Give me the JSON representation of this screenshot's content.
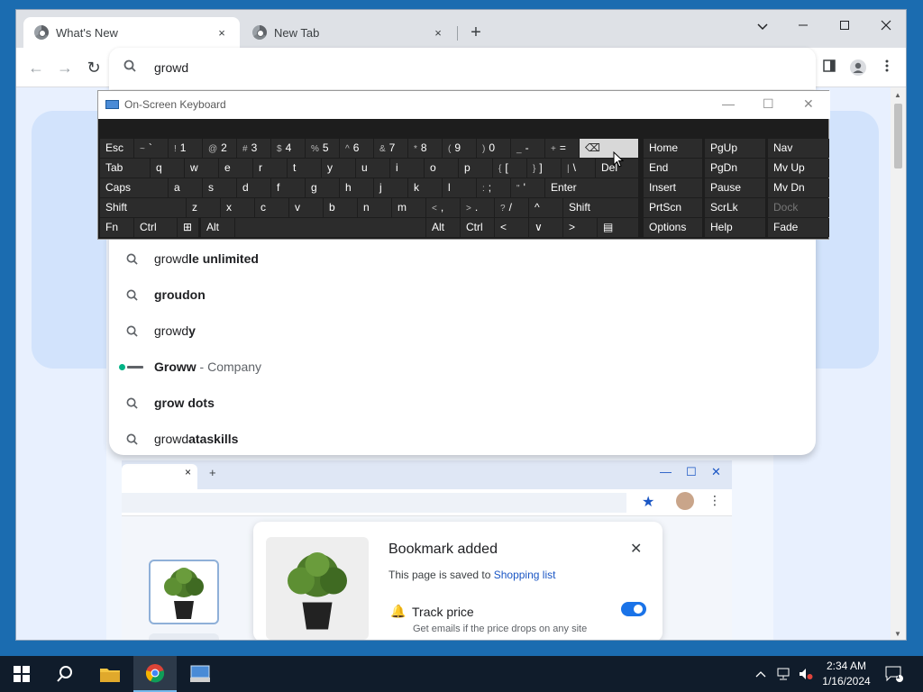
{
  "browser": {
    "tabs": [
      {
        "title": "What's New",
        "close": "×"
      },
      {
        "title": "New Tab",
        "close": "×"
      }
    ],
    "new_tab": "+",
    "window_controls": {
      "dropdown": "⌄",
      "minimize": "—",
      "maximize": "☐",
      "close": "✕"
    },
    "nav": {
      "back": "←",
      "forward": "→",
      "reload": "↻"
    },
    "omnibox": {
      "value": "growd"
    },
    "suggestions": [
      {
        "prefix": "growd",
        "bold": "le unlimited",
        "sub": "",
        "icon": "search-icon"
      },
      {
        "prefix": "",
        "bold": "groudon",
        "sub": "",
        "icon": "search-icon"
      },
      {
        "prefix": "growd",
        "bold": "y",
        "sub": "",
        "icon": "search-icon"
      },
      {
        "prefix": "",
        "bold": "Groww",
        "sub": " - Company",
        "icon": "groww-logo-icon"
      },
      {
        "prefix": "",
        "bold": "grow dots",
        "sub": "",
        "icon": "search-icon"
      },
      {
        "prefix": "growd",
        "bold": "ataskills",
        "sub": "",
        "icon": "search-icon"
      }
    ]
  },
  "page": {
    "mock_window": {
      "tab_close": "×",
      "new_tab": "+"
    },
    "bookmark_dialog": {
      "title": "Bookmark added",
      "saved_text": "This page is saved to ",
      "saved_link": "Shopping list",
      "track_label": "Track price",
      "track_sub": "Get emails if the price drops on any site",
      "track_on": true,
      "close": "✕"
    }
  },
  "osk": {
    "title": "On-Screen Keyboard",
    "rows": [
      [
        {
          "label": "Esc"
        },
        {
          "shift": "~",
          "label": "`"
        },
        {
          "shift": "!",
          "label": "1"
        },
        {
          "shift": "@",
          "label": "2"
        },
        {
          "shift": "#",
          "label": "3"
        },
        {
          "shift": "$",
          "label": "4"
        },
        {
          "shift": "%",
          "label": "5"
        },
        {
          "shift": "^",
          "label": "6"
        },
        {
          "shift": "&",
          "label": "7"
        },
        {
          "shift": "*",
          "label": "8"
        },
        {
          "shift": "(",
          "label": "9"
        },
        {
          "shift": ")",
          "label": "0"
        },
        {
          "shift": "_",
          "label": "-"
        },
        {
          "shift": "+",
          "label": "="
        },
        {
          "label": "⌫"
        }
      ],
      [
        {
          "label": "Tab"
        },
        {
          "label": "q"
        },
        {
          "label": "w"
        },
        {
          "label": "e"
        },
        {
          "label": "r"
        },
        {
          "label": "t"
        },
        {
          "label": "y"
        },
        {
          "label": "u"
        },
        {
          "label": "i"
        },
        {
          "label": "o"
        },
        {
          "label": "p"
        },
        {
          "shift": "{",
          "label": "["
        },
        {
          "shift": "}",
          "label": "]"
        },
        {
          "shift": "|",
          "label": "\\"
        },
        {
          "label": "Del"
        }
      ],
      [
        {
          "label": "Caps"
        },
        {
          "label": "a"
        },
        {
          "label": "s"
        },
        {
          "label": "d"
        },
        {
          "label": "f"
        },
        {
          "label": "g"
        },
        {
          "label": "h"
        },
        {
          "label": "j"
        },
        {
          "label": "k"
        },
        {
          "label": "l"
        },
        {
          "shift": ":",
          "label": ";"
        },
        {
          "shift": "\"",
          "label": "'"
        },
        {
          "label": "Enter"
        }
      ],
      [
        {
          "label": "Shift"
        },
        {
          "label": "z"
        },
        {
          "label": "x"
        },
        {
          "label": "c"
        },
        {
          "label": "v"
        },
        {
          "label": "b"
        },
        {
          "label": "n"
        },
        {
          "label": "m"
        },
        {
          "shift": "<",
          "label": ","
        },
        {
          "shift": ">",
          "label": "."
        },
        {
          "shift": "?",
          "label": "/"
        },
        {
          "label": "^"
        },
        {
          "label": "Shift"
        }
      ],
      [
        {
          "label": "Fn"
        },
        {
          "label": "Ctrl"
        },
        {
          "label": "⊞"
        },
        {
          "label": "Alt"
        },
        {
          "label": ""
        },
        {
          "label": "Alt"
        },
        {
          "label": "Ctrl"
        },
        {
          "label": "<"
        },
        {
          "label": "∨"
        },
        {
          "label": ">"
        },
        {
          "label": "▤"
        }
      ]
    ],
    "nav_keys": [
      [
        "Home",
        "PgUp",
        "Nav"
      ],
      [
        "End",
        "PgDn",
        "Mv Up"
      ],
      [
        "Insert",
        "Pause",
        "Mv Dn"
      ],
      [
        "PrtScn",
        "ScrLk",
        "Dock"
      ],
      [
        "Options",
        "Help",
        "Fade"
      ]
    ]
  },
  "taskbar": {
    "time": "2:34 AM",
    "date": "1/16/2024",
    "notification_count": "1"
  }
}
